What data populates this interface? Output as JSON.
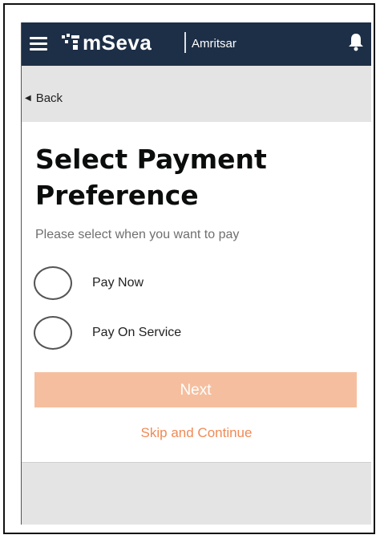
{
  "header": {
    "app_name": "mSeva",
    "city": "Amritsar",
    "menu_icon": "hamburger-menu-icon",
    "logo_icon": "mseva-logo-icon",
    "notification_icon": "bell-icon",
    "background_color": "#1d2f47"
  },
  "nav": {
    "back_label": "Back"
  },
  "main": {
    "title_line1": "Select Payment",
    "title_line2": "Preference",
    "subtitle": "Please select when you want to pay",
    "options": [
      {
        "label": "Pay Now",
        "selected": false
      },
      {
        "label": "Pay On Service",
        "selected": false
      }
    ],
    "next_label": "Next",
    "skip_label": "Skip and Continue"
  },
  "colors": {
    "accent": "#f08a55",
    "button_disabled": "#f5bf9f"
  }
}
